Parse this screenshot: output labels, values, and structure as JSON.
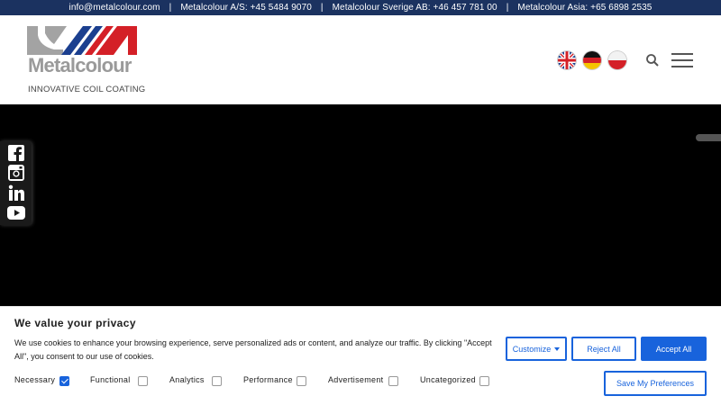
{
  "topbar": {
    "email": "info@metalcolour.com",
    "separator": "|",
    "phone_as": "Metalcolour A/S: +45 5484 9070",
    "phone_se": "Metalcolour Sverige AB: +46 457 781 00",
    "phone_asia": "Metalcolour Asia: +65 6898 2535"
  },
  "header": {
    "logo_word": "Metalcolour",
    "logo_tagline": "INNOVATIVE COIL COATING",
    "flags": [
      "english-flag-icon",
      "german-flag-icon",
      "polish-flag-icon"
    ],
    "search_icon": "search-icon",
    "menu_icon": "hamburger-menu-icon"
  },
  "social": [
    "facebook-icon",
    "instagram-icon",
    "linkedin-icon",
    "youtube-icon"
  ],
  "cookie": {
    "title": "We value your privacy",
    "text": "We use cookies to enhance your browsing experience, serve personalized ads or content, and analyze our traffic. By clicking \"Accept All\", you consent to our use of cookies.",
    "customize_label": "Customize",
    "reject_label": "Reject All",
    "accept_label": "Accept All",
    "save_label": "Save My Preferences",
    "categories": [
      {
        "label": "Necessary",
        "checked": true
      },
      {
        "label": "Functional",
        "checked": false
      },
      {
        "label": "Analytics",
        "checked": false
      },
      {
        "label": "Performance",
        "checked": false
      },
      {
        "label": "Advertisement",
        "checked": false
      },
      {
        "label": "Uncategorized",
        "checked": false
      }
    ]
  },
  "colors": {
    "topbar_bg": "#1b3260",
    "accent": "#1863dc",
    "logo_red": "#d42027",
    "logo_blue": "#1b3f8f",
    "logo_gray": "#9a9a9a"
  }
}
